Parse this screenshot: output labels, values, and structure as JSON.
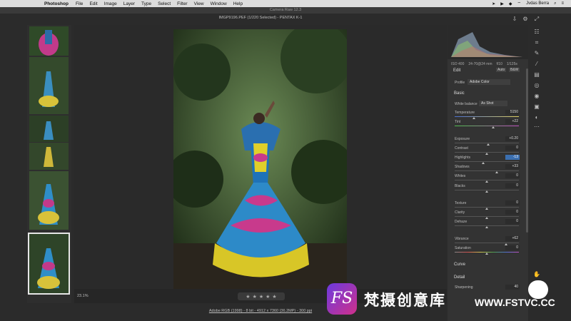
{
  "menubar": {
    "app": "Photoshop",
    "items": [
      "File",
      "Edit",
      "Image",
      "Layer",
      "Type",
      "Select",
      "Filter",
      "View",
      "Window",
      "Help"
    ],
    "user": "Jvdas Berra"
  },
  "window_title": "Camera Raw 12.3",
  "doc_title": "IMGP9196.PEF (1/220 Selected)  -  PENTAX K-1",
  "zoom": "23.1%",
  "file_info": "Adobe RGB (1998) - 8 bit - 4912 x 7360 (36.2MP) - 300 ppi",
  "stars": [
    "★",
    "★",
    "★",
    "★",
    "★"
  ],
  "exif": {
    "iso": "ISO 400",
    "lens": "24-70@24 mm",
    "aperture": "f/10",
    "shutter": "1/125s"
  },
  "edit": {
    "label": "Edit",
    "auto": "Auto",
    "bw": "B&W"
  },
  "profile": {
    "label": "Profile",
    "value": "Adobe Color"
  },
  "basic": {
    "title": "Basic",
    "white_balance_label": "White balance",
    "white_balance_value": "As Shot",
    "rows": [
      {
        "label": "Temperature",
        "value": "5150",
        "pos": 0.3
      },
      {
        "label": "Tint",
        "value": "+22",
        "pos": 0.6
      },
      {
        "label": "Exposure",
        "value": "+0.20",
        "pos": 0.52
      },
      {
        "label": "Contrast",
        "value": "0",
        "pos": 0.5
      },
      {
        "label": "Highlights",
        "value": "-13",
        "pos": 0.44
      },
      {
        "label": "Shadows",
        "value": "+33",
        "pos": 0.66
      },
      {
        "label": "Whites",
        "value": "0",
        "pos": 0.5
      },
      {
        "label": "Blacks",
        "value": "0",
        "pos": 0.5
      },
      {
        "label": "Texture",
        "value": "0",
        "pos": 0.5
      },
      {
        "label": "Clarity",
        "value": "0",
        "pos": 0.5
      },
      {
        "label": "Dehaze",
        "value": "0",
        "pos": 0.5
      },
      {
        "label": "Vibrance",
        "value": "+62",
        "pos": 0.8
      },
      {
        "label": "Saturation",
        "value": "0",
        "pos": 0.5
      }
    ]
  },
  "curve": {
    "title": "Curve"
  },
  "detail": {
    "title": "Detail",
    "sharpening_label": "Sharpening",
    "sharpening_value": "40"
  },
  "watermark": {
    "logo": "FS",
    "text": "梵摄创意库",
    "url": "WWW.FSTVC.CC"
  }
}
